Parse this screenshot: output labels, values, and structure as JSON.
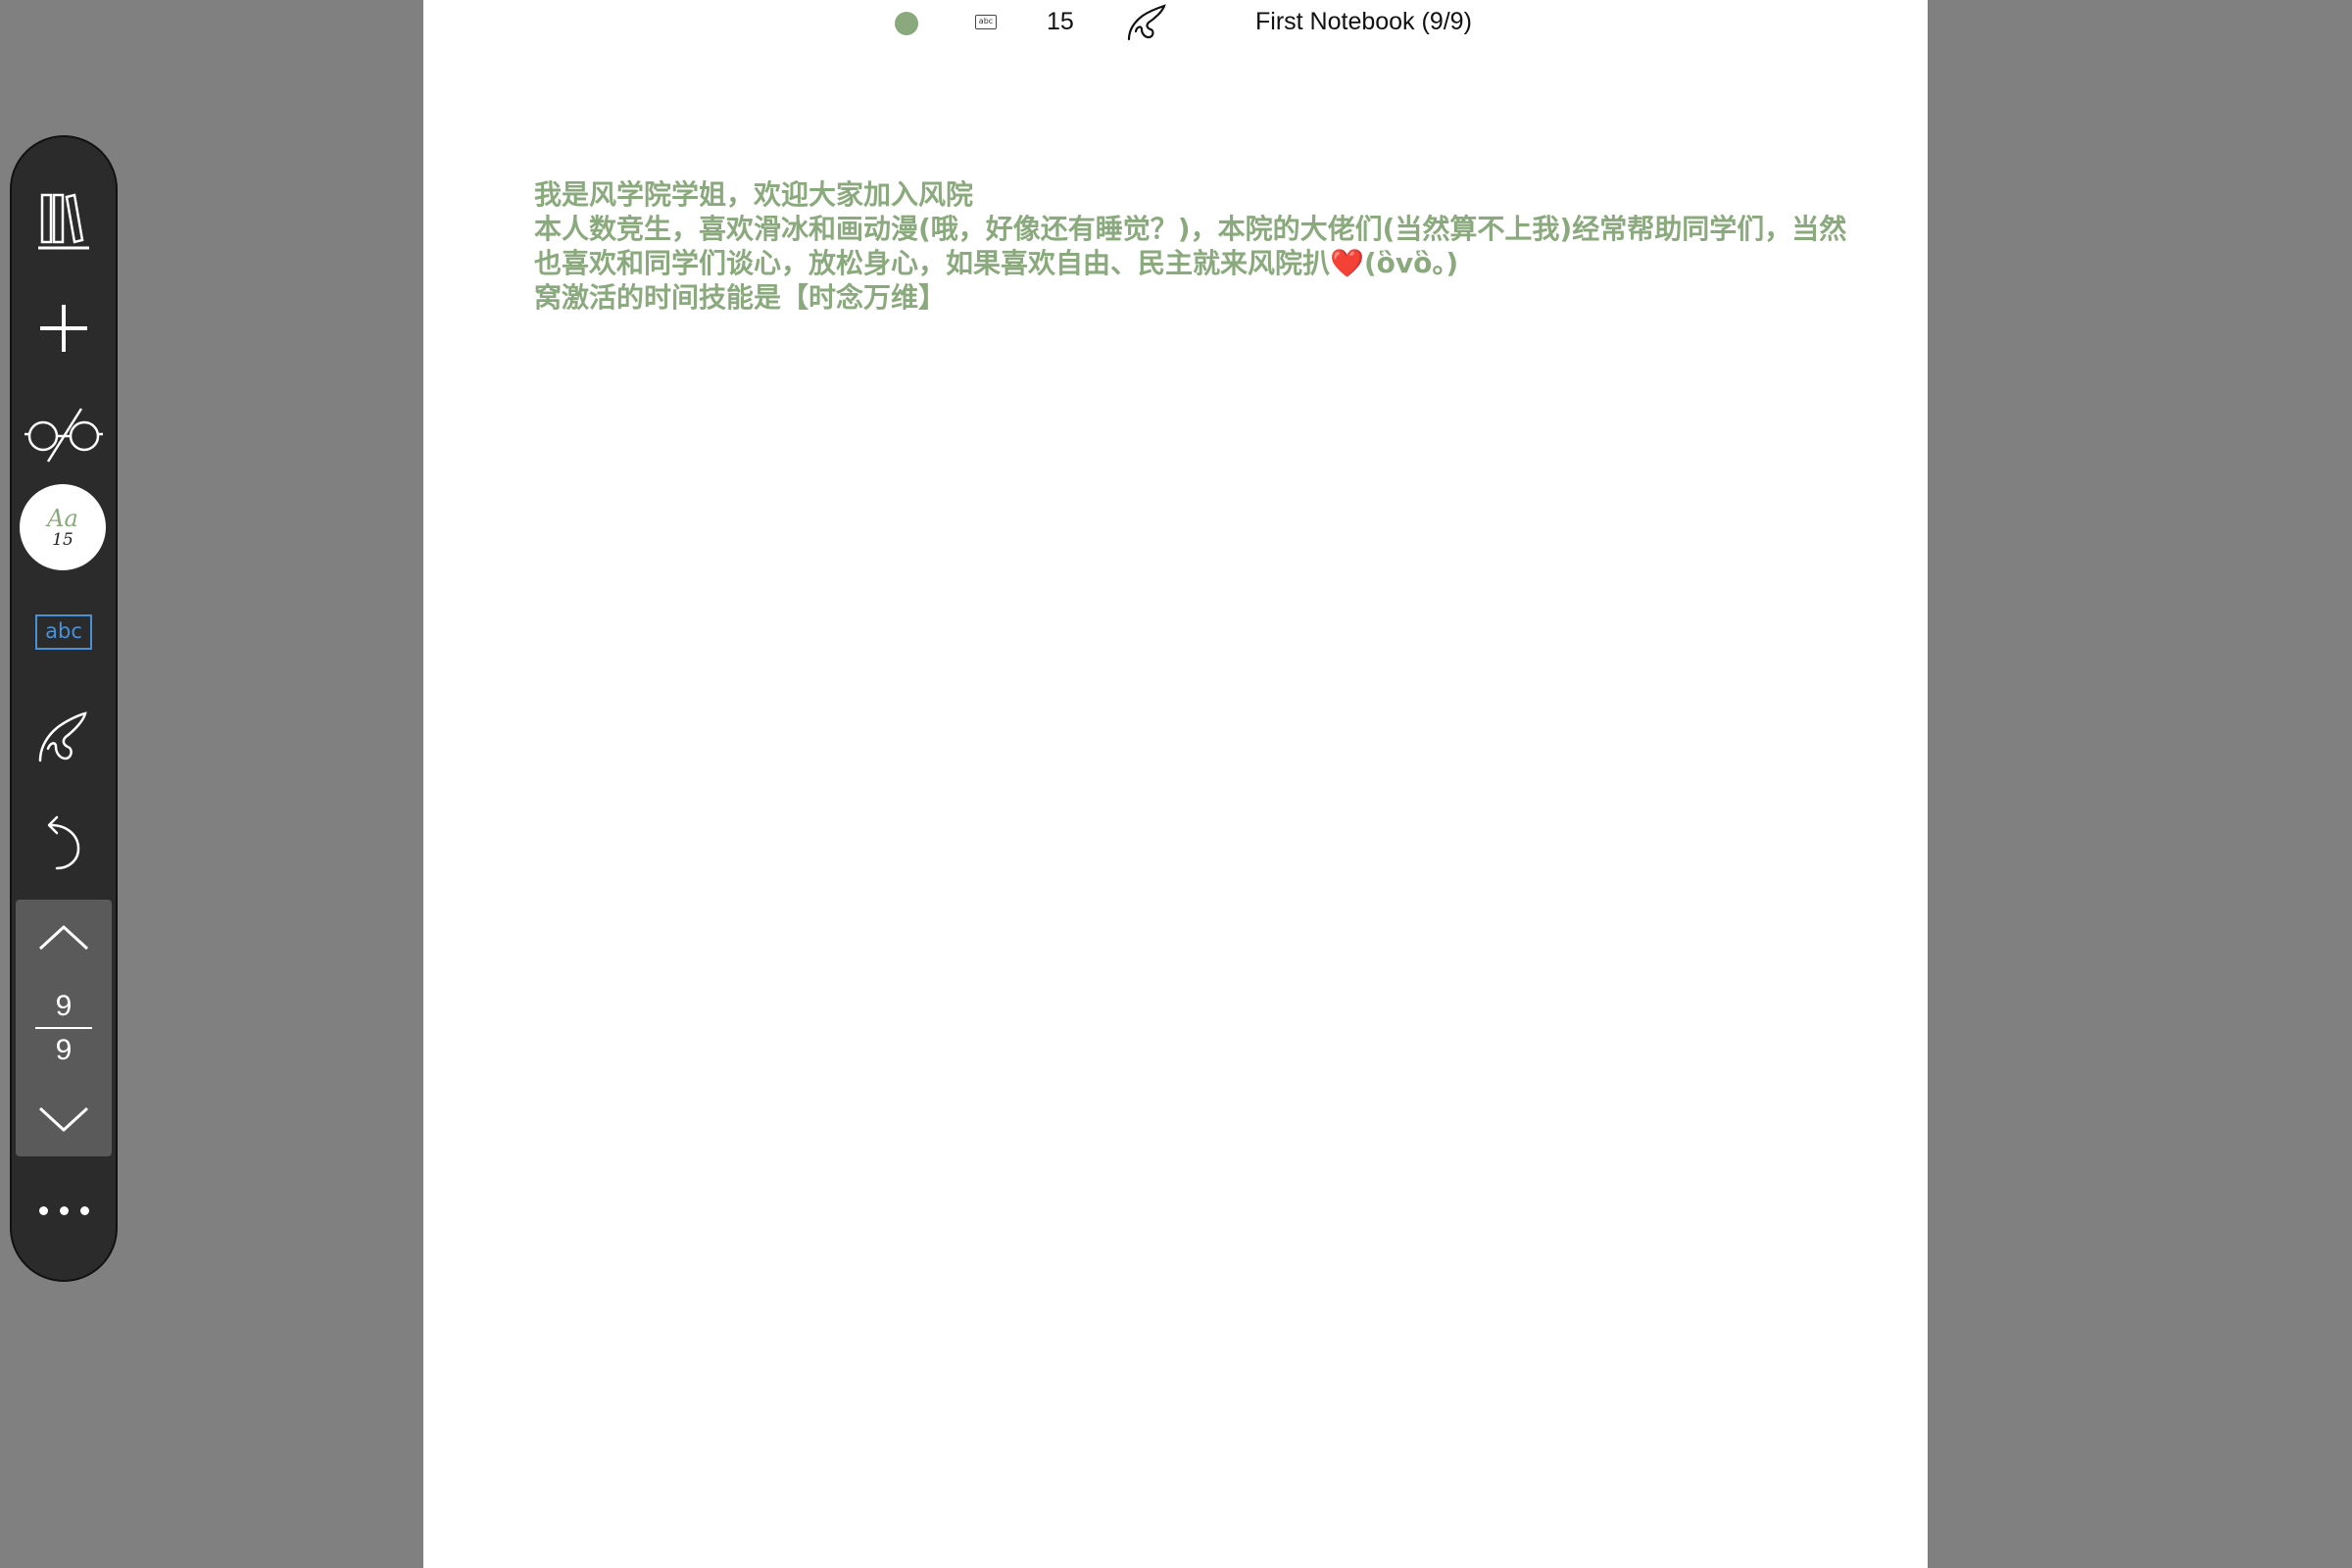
{
  "colors": {
    "background": "#808080",
    "page": "#ffffff",
    "ink": "#8aaa7d",
    "toolbar": "#2b2b2b",
    "highlight": "#4a90d9"
  },
  "status_bar": {
    "color_swatch": "#8aaa7d",
    "text_mode_label": "abc",
    "font_size": "15",
    "pen_icon": "pen-gesture-icon",
    "notebook_title": "First Notebook (9/9)"
  },
  "note": {
    "lines": [
      "我是风学院学姐，欢迎大家加入风院",
      "本人数竞生，喜欢滑冰和画动漫(哦，好像还有睡觉？)，本院的大佬们(当然算不上我)经常帮助同学们，当然",
      "也喜欢和同学们谈心，放松身心，如果喜欢自由、民主就来风院扒❤️(ὃvὃ。)",
      "窝激活的时间技能是【时念万维】"
    ]
  },
  "toolbar": {
    "library_icon": "library-books-icon",
    "add_icon": "plus-icon",
    "view_icon": "glasses-icon",
    "font_button": {
      "sample": "Aa",
      "size": "15"
    },
    "text_mode_label": "abc",
    "pen_icon": "pen-gesture-icon",
    "undo_icon": "undo-icon",
    "pager": {
      "current": "9",
      "total": "9"
    },
    "more_icon": "more-dots-icon"
  }
}
